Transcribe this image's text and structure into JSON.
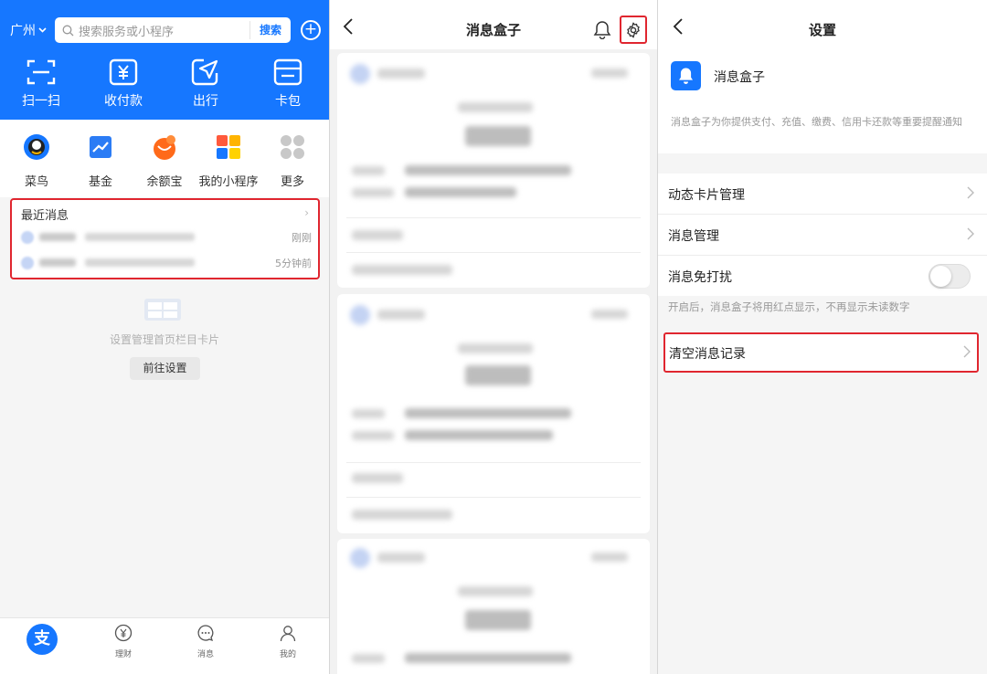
{
  "panel1": {
    "city": "广州",
    "search": {
      "placeholder": "搜索服务或小程序",
      "button": "搜索"
    },
    "big_actions": [
      {
        "label": "扫一扫",
        "icon": "scan-icon"
      },
      {
        "label": "收付款",
        "icon": "payment-icon"
      },
      {
        "label": "出行",
        "icon": "travel-icon"
      },
      {
        "label": "卡包",
        "icon": "wallet-icon"
      }
    ],
    "apps": [
      {
        "label": "菜鸟",
        "icon": "cainiao-icon"
      },
      {
        "label": "基金",
        "icon": "fund-icon"
      },
      {
        "label": "余额宝",
        "icon": "yuebao-icon"
      },
      {
        "label": "我的小程序",
        "icon": "mini-program-icon"
      },
      {
        "label": "更多",
        "icon": "more-icon"
      }
    ],
    "recent": {
      "title": "最近消息",
      "items": [
        {
          "time": "刚刚"
        },
        {
          "time": "5分钟前"
        }
      ]
    },
    "empty": {
      "text": "设置管理首页栏目卡片",
      "button": "前往设置"
    },
    "tabbar": [
      {
        "label": "",
        "icon": "alipay-home-icon"
      },
      {
        "label": "理财",
        "icon": "wealth-icon"
      },
      {
        "label": "消息",
        "icon": "message-icon"
      },
      {
        "label": "我的",
        "icon": "profile-icon"
      }
    ],
    "home_glyph": "支"
  },
  "panel2": {
    "title": "消息盒子"
  },
  "panel3": {
    "title": "设置",
    "header": {
      "name": "消息盒子",
      "description": "消息盒子为你提供支付、充值、缴费、信用卡还款等重要提醒通知"
    },
    "rows": [
      {
        "label": "动态卡片管理"
      },
      {
        "label": "消息管理"
      },
      {
        "label": "消息免打扰"
      }
    ],
    "dnd_enabled": false,
    "hint": "开启后，消息盒子将用红点显示，不再显示未读数字",
    "clear_row": "清空消息记录"
  },
  "colors": {
    "brand_blue": "#1677ff",
    "highlight_red": "#e0262f"
  }
}
